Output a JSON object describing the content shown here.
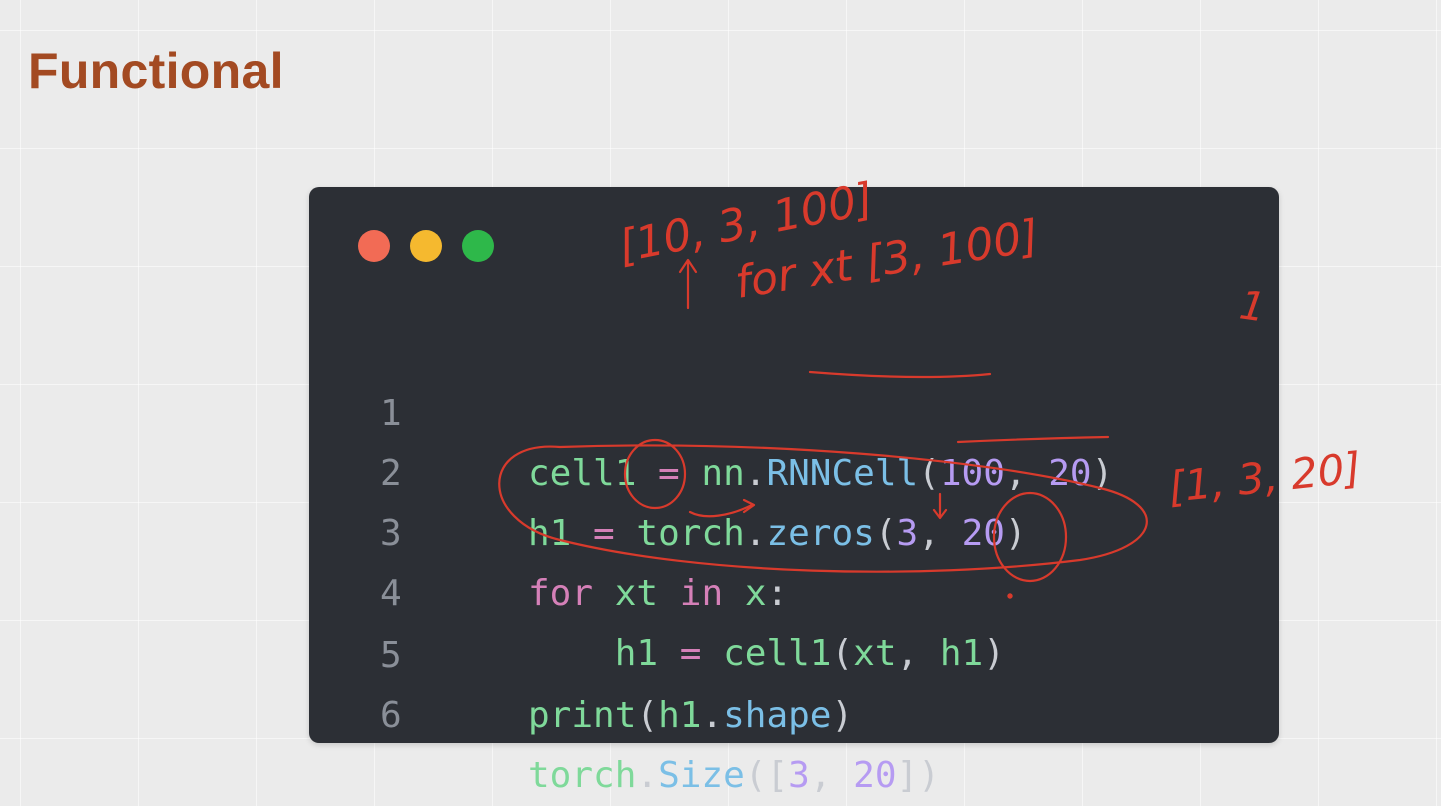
{
  "slide": {
    "title": "Functional"
  },
  "code_window": {
    "background": "#2c2f35",
    "traffic_lights": [
      "#f26b55",
      "#f5b92f",
      "#2eb84a"
    ]
  },
  "syntax_colors": {
    "variable": "#7fd99a",
    "keyword": "#d580b8",
    "function": "#7bbfe6",
    "number": "#b69bf2",
    "plain": "#c9ccd2",
    "line_number": "#8a8f98"
  },
  "code": {
    "lines": [
      {
        "number": "1",
        "t1": "cell1",
        "t2": " = ",
        "t3": "nn",
        "t4": ".",
        "t5": "RNNCell",
        "t6": "(",
        "t7": "100",
        "t8": ", ",
        "t9": "20",
        "t10": ")"
      },
      {
        "number": "2",
        "t1": "h1",
        "t2": " = ",
        "t3": "torch",
        "t4": ".",
        "t5": "zeros",
        "t6": "(",
        "t7": "3",
        "t8": ", ",
        "t9": "20",
        "t10": ")"
      },
      {
        "number": "3",
        "t1": "for",
        "t2": " ",
        "t3": "xt",
        "t4": " ",
        "t5": "in",
        "t6": " ",
        "t7": "x",
        "t8": ":"
      },
      {
        "number": "4",
        "indent": "    ",
        "t1": "h1",
        "t2": " = ",
        "t3": "cell1",
        "t4": "(",
        "t5": "xt",
        "t6": ", ",
        "t7": "h1",
        "t8": ")"
      },
      {
        "number": "5",
        "t1": "print",
        "t2": "(",
        "t3": "h1",
        "t4": ".",
        "t5": "shape",
        "t6": ")"
      },
      {
        "number": "6",
        "t1": "torch",
        "t2": ".",
        "t3": "Size",
        "t4": "([",
        "t5": "3",
        "t6": ", ",
        "t7": "20",
        "t8": "])"
      }
    ]
  },
  "annotations": {
    "ink_color": "#d83a2c",
    "seq_shape": "[10, 3, 100]",
    "for_note": "for xt [3, 100]",
    "one_mark": "1",
    "h_shape": "[1, 3, 20]"
  }
}
